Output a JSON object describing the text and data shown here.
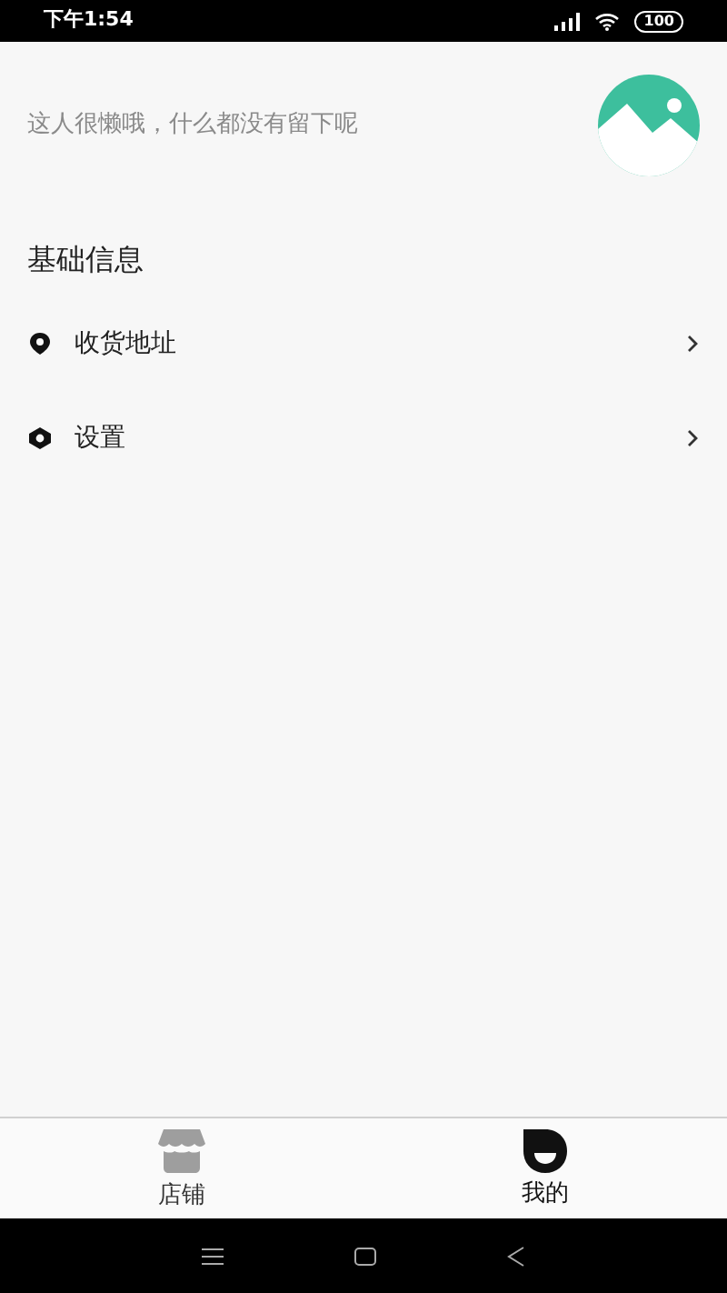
{
  "status_bar": {
    "time": "下午1:54",
    "battery": "100"
  },
  "profile": {
    "bio": "这人很懒哦，什么都没有留下呢"
  },
  "section": {
    "title": "基础信息"
  },
  "menu": [
    {
      "kind": "address",
      "label": "收货地址"
    },
    {
      "kind": "settings",
      "label": "设置"
    }
  ],
  "tab_bar": [
    {
      "kind": "shop",
      "label": "店铺",
      "selected": false
    },
    {
      "kind": "mine",
      "label": "我的",
      "selected": true
    }
  ]
}
